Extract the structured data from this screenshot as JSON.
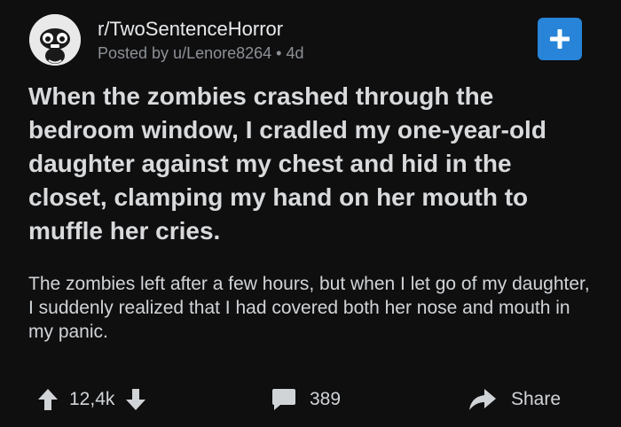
{
  "post": {
    "subreddit": "r/TwoSentenceHorror",
    "posted_by": "Posted by u/Lenore8264",
    "separator": "•",
    "age": "4d",
    "title": "When the zombies crashed through the bedroom window, I cradled my one-year-old daughter against my chest and hid in the closet, clamping my hand on her mouth to muffle her cries.",
    "body": "The zombies left after a few hours, but when I let go of my daughter, I suddenly realized that I had covered both her nose and mouth in my panic."
  },
  "actions": {
    "vote_count": "12,4k",
    "comment_count": "389",
    "share_label": "Share"
  },
  "icons": {
    "join": "plus-icon",
    "upvote": "arrow-up-icon",
    "downvote": "arrow-down-icon",
    "comments": "comment-bubble-icon",
    "share": "share-arrow-icon",
    "avatar": "subreddit-avatar-icon"
  },
  "colors": {
    "background": "#0f0f10",
    "accent": "#2784d8",
    "text_primary": "#d8dadc",
    "text_muted": "#8d9196"
  }
}
